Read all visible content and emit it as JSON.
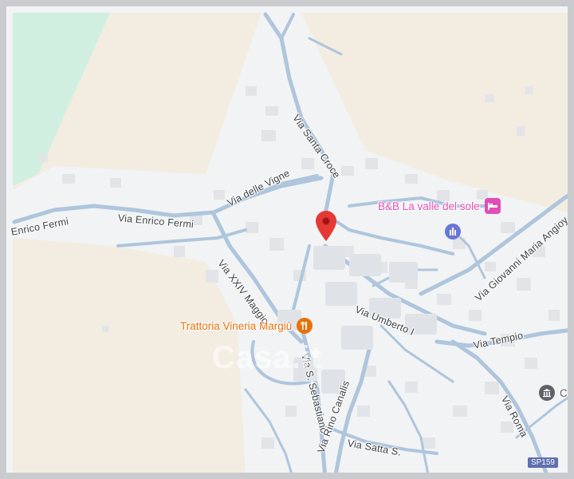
{
  "colors": {
    "land": "#f1f3f4",
    "sand": "#f3ece0",
    "green": "#d1efe0",
    "road": "#aec5dc",
    "road_outline": "#9fb7cf",
    "building": "#e4e6ea",
    "pin": "#e53935",
    "hotel": "#e04fb5",
    "restaurant": "#e8710a",
    "worship": "#6a75d6",
    "museum": "#5f6368"
  },
  "streets": {
    "enrico_fermi_left": "Enrico Fermi",
    "enrico_fermi": "Via Enrico Fermi",
    "delle_vigne": "Via delle Vigne",
    "santa_croce": "Via Santa Croce",
    "xxiv_maggio": "Via XXIV Maggio",
    "umberto": "Via Umberto I",
    "sebastiano": "Via S. Sebastiano",
    "rino_canalis": "Via Rino Canalis",
    "satta": "Via Satta S.",
    "tempio": "Via Tempio",
    "roma": "Via Roma",
    "giovanni_maria_angioy": "Via Giovanni Maria Angioy"
  },
  "pois": {
    "hotel": {
      "label": "B&B La valle del sole",
      "icon": "bed-icon"
    },
    "restaurant": {
      "label": "Trattoria Vineria Margiù",
      "icon": "cutlery-icon"
    },
    "worship": {
      "icon": "place-of-worship-icon"
    },
    "museum": {
      "label": "Co",
      "icon": "museum-icon"
    }
  },
  "marker": {
    "icon": "location-pin-icon"
  },
  "watermark": {
    "text": "Casa.it"
  },
  "route_badge": "SP159"
}
